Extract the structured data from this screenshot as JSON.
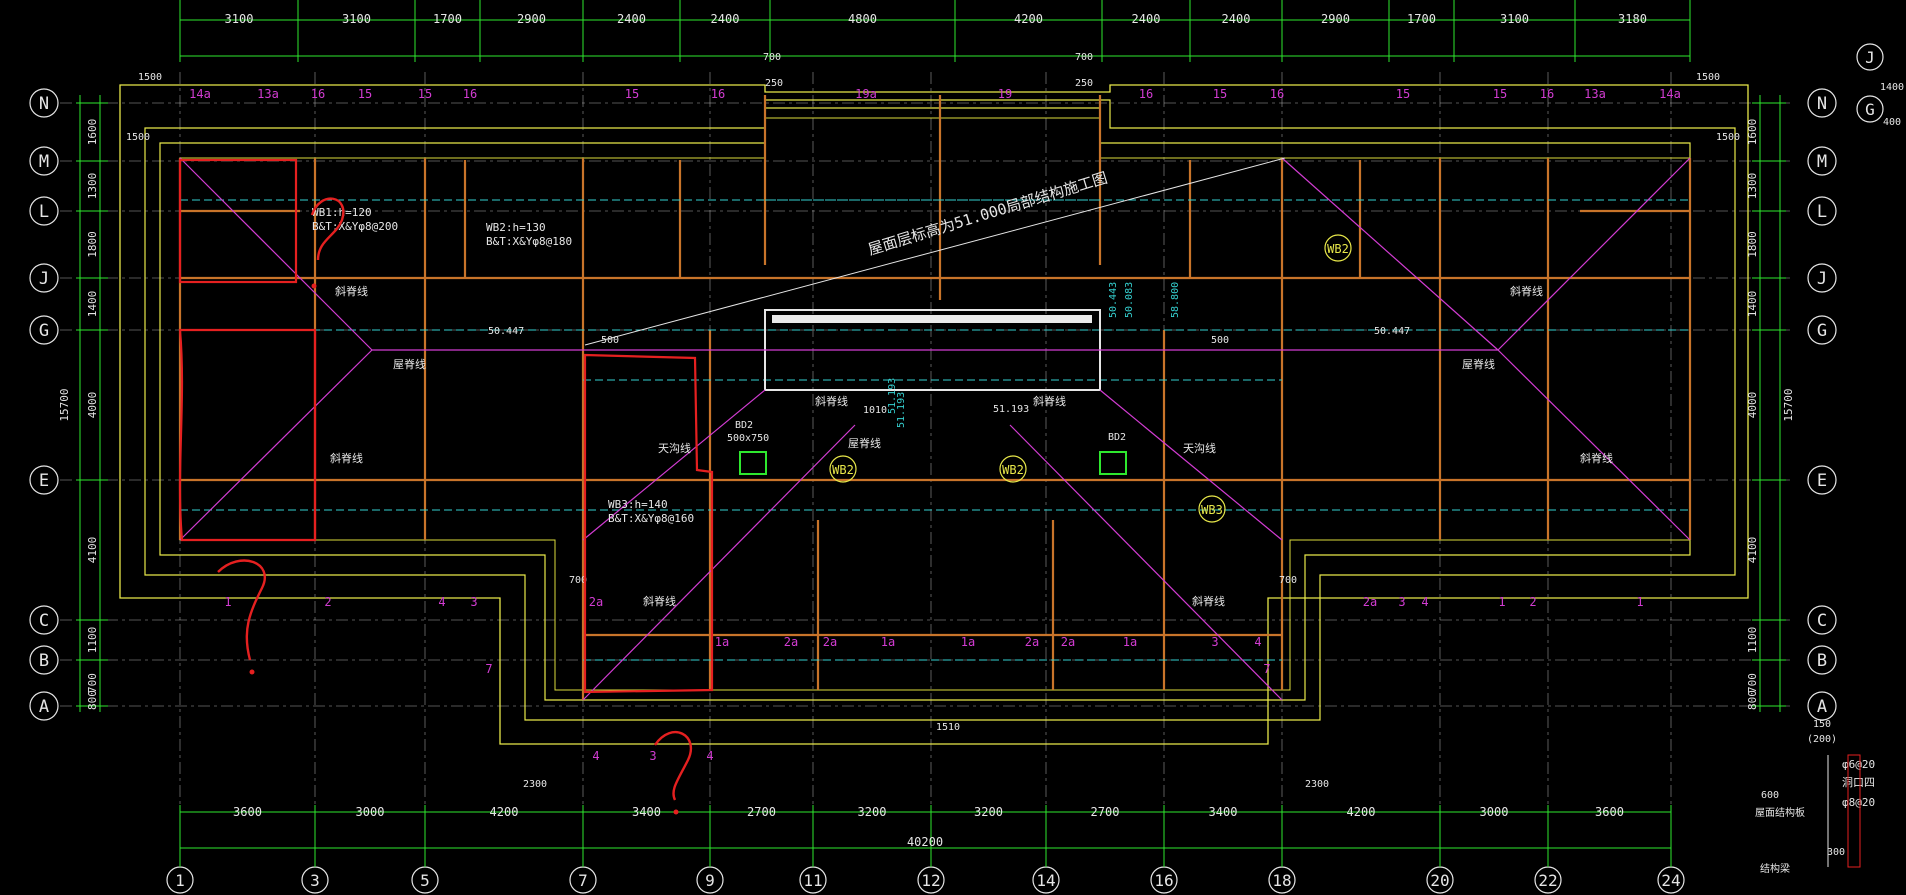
{
  "drawing": {
    "title": "屋面层标高为51.000局部结构施工图",
    "top_dims": [
      "3100",
      "3100",
      "1700",
      "2900",
      "2400",
      "2400",
      "4800",
      "4200",
      "2400",
      "2400",
      "2900",
      "1700",
      "3100",
      "3180"
    ],
    "bottom_dims": [
      "3600",
      "3000",
      "4200",
      "3400",
      "2700",
      "3200",
      "3200",
      "2700",
      "3400",
      "4200",
      "3000",
      "3600"
    ],
    "total_dim": "40200",
    "axes_bottom": [
      "1",
      "3",
      "5",
      "7",
      "9",
      "11",
      "12",
      "14",
      "16",
      "18",
      "20",
      "22",
      "24"
    ],
    "axes_side": [
      "N",
      "M",
      "L",
      "J",
      "G",
      "E",
      "C",
      "B",
      "A"
    ],
    "axes_right_extra": [
      "J",
      "G"
    ],
    "left_dims": [
      "1600",
      "1300",
      "1800",
      "1400",
      "4000",
      "4100",
      "1100",
      "700",
      "800"
    ],
    "left_total": "15700",
    "right_total": "15700",
    "dims_small": [
      "1500",
      "1500",
      "700",
      "700",
      "250",
      "250",
      "700",
      "700",
      "2300",
      "2300",
      "150",
      "(200)",
      "600",
      "300",
      "1400",
      "400",
      "1500",
      "1500",
      "1510",
      "500",
      "500",
      "1010"
    ],
    "slabs": [
      {
        "id": "WB1",
        "text1": "WB1:h=120",
        "text2": "B&T:X&Yφ8@200"
      },
      {
        "id": "WB2",
        "text1": "WB2:h=130",
        "text2": "B&T:X&Yφ8@180"
      },
      {
        "id": "WB3",
        "text1": "WB3:h=140",
        "text2": "B&T:X&Yφ8@160"
      }
    ],
    "slab_tags": [
      "WB2",
      "WB2",
      "WB2",
      "WB3"
    ],
    "elevations": [
      "50.447",
      "50.447",
      "51.193",
      "51.193",
      "51.193",
      "50.443",
      "50.083",
      "58.800"
    ],
    "notes": {
      "slope": "斜脊线",
      "ridge": "屋脊线",
      "valley": "天沟线",
      "bd2": "BD2",
      "bd2_size": "500x750",
      "detail1": "φ6@20",
      "detail2": "洞口四",
      "detail3": "φ8@20",
      "detail4": "屋面结构板",
      "detail5": "结构梁"
    },
    "beam_tags_top": [
      "14a",
      "13a",
      "16",
      "15",
      "15",
      "16",
      "15",
      "16",
      "19a",
      "19",
      "16",
      "15",
      "16",
      "15",
      "15",
      "16",
      "13a",
      "14a"
    ],
    "beam_tags_bottom": [
      "1",
      "2",
      "4",
      "3",
      "2a",
      "7",
      "4",
      "3",
      "4",
      "1a",
      "2a",
      "2a",
      "1a",
      "1a",
      "2a",
      "2a",
      "1a",
      "3",
      "4",
      "7",
      "2a",
      "3",
      "4",
      "1",
      "2",
      "1"
    ]
  }
}
